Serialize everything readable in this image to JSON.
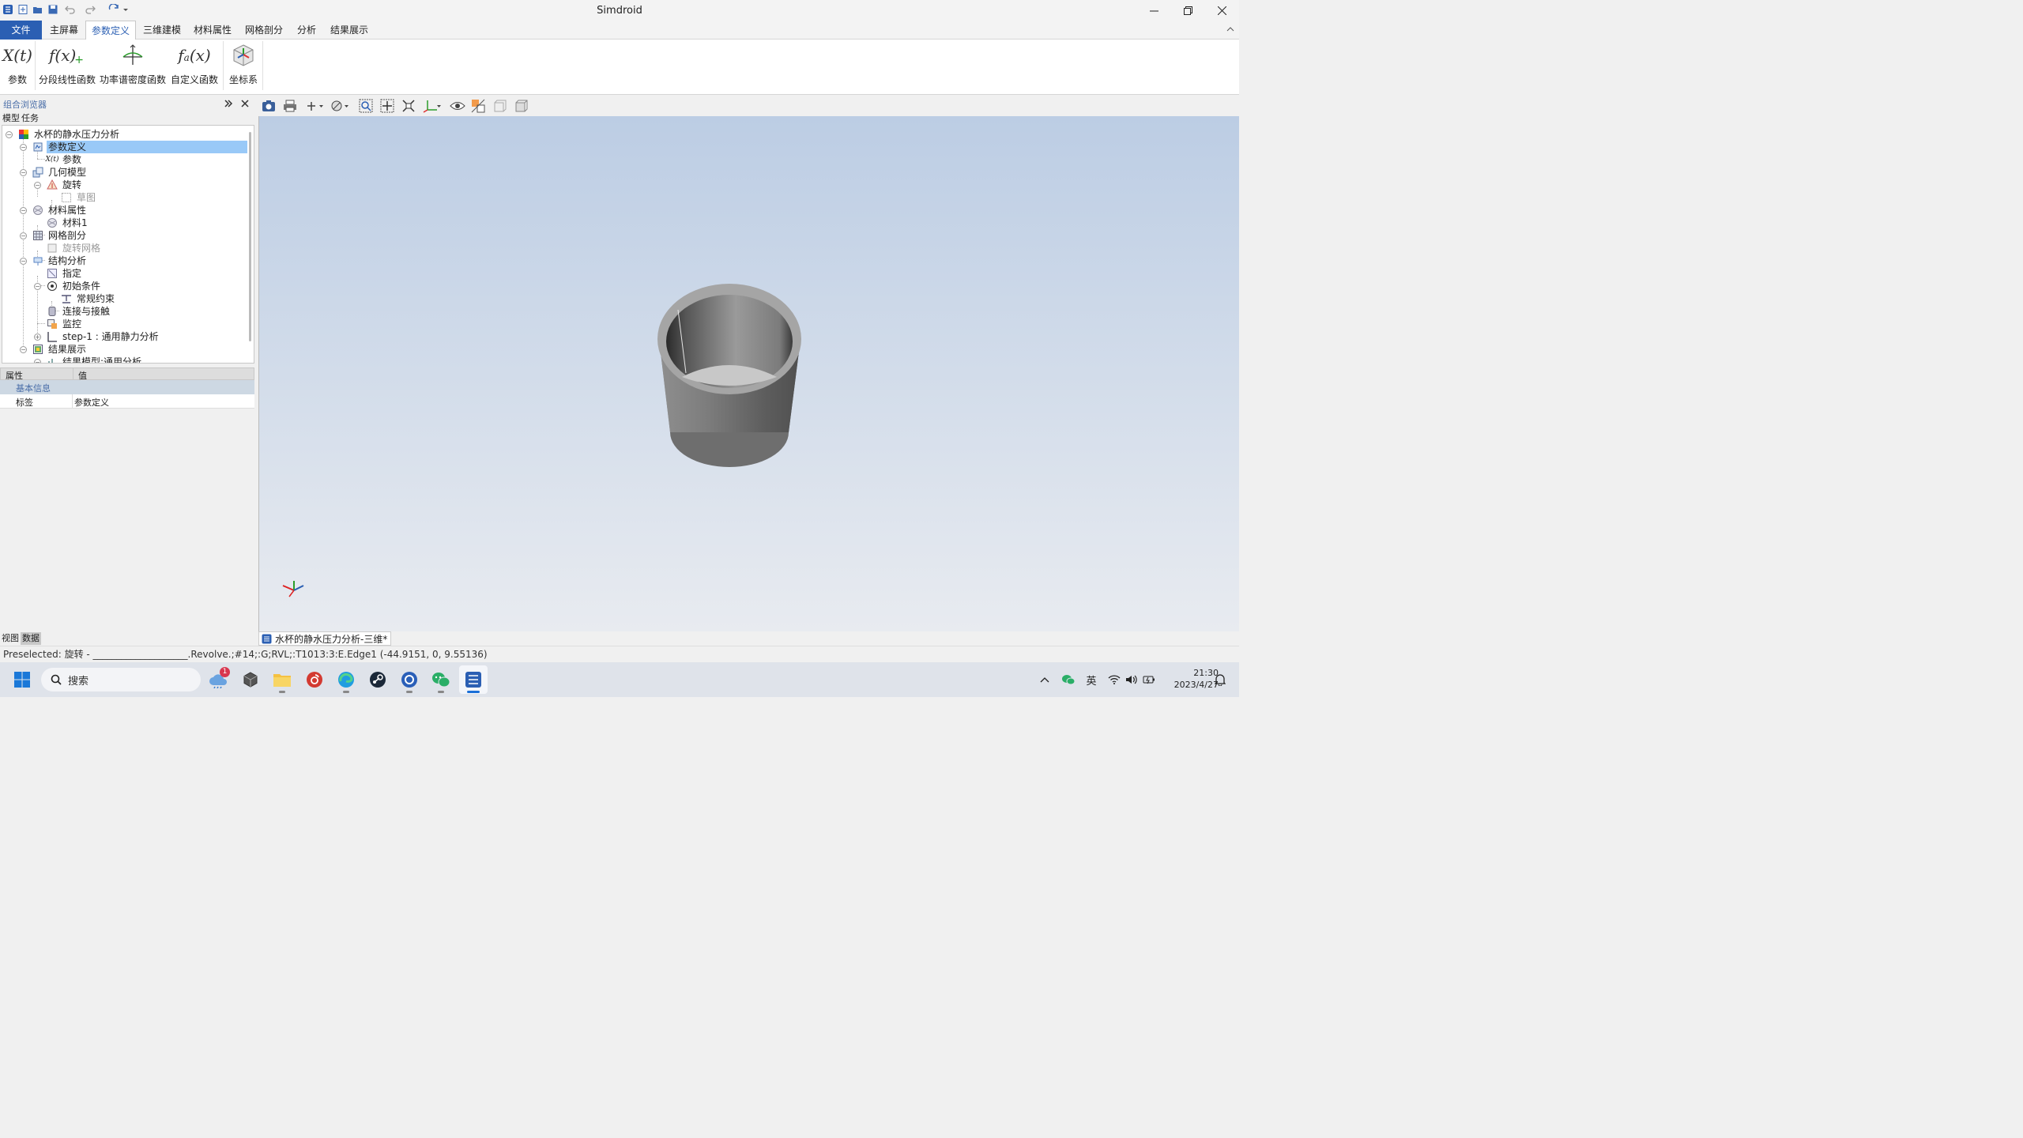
{
  "app": {
    "title": "Simdroid"
  },
  "menu": {
    "tabs": [
      {
        "label": "文件"
      },
      {
        "label": "主屏幕"
      },
      {
        "label": "参数定义"
      },
      {
        "label": "三维建模"
      },
      {
        "label": "材料属性"
      },
      {
        "label": "网格剖分"
      },
      {
        "label": "分析"
      },
      {
        "label": "结果展示"
      }
    ],
    "active": "参数定义"
  },
  "ribbon": {
    "buttons": [
      {
        "label": "参数",
        "icon": "param-x-t-icon"
      },
      {
        "label": "分段线性函数",
        "icon": "piecewise-function-icon"
      },
      {
        "label": "功率谱密度函数",
        "icon": "psd-function-icon"
      },
      {
        "label": "自定义函数",
        "icon": "custom-function-icon"
      },
      {
        "label": "坐标系",
        "icon": "coordinate-system-icon"
      }
    ]
  },
  "browser": {
    "title": "组合浏览器",
    "tabs": [
      "模型",
      "任务"
    ],
    "tree": [
      {
        "label": "水杯的静水压力分析",
        "icon": "analysis-root-icon"
      },
      {
        "label": "参数定义",
        "icon": "param-def-icon",
        "selected": true
      },
      {
        "label": "参数",
        "icon": "param-x-t-icon"
      },
      {
        "label": "几何模型",
        "icon": "geometry-icon"
      },
      {
        "label": "旋转",
        "icon": "revolve-icon"
      },
      {
        "label": "草图",
        "icon": "sketch-icon",
        "disabled": true
      },
      {
        "label": "材料属性",
        "icon": "material-icon"
      },
      {
        "label": "材料1",
        "icon": "material-icon"
      },
      {
        "label": "网格剖分",
        "icon": "mesh-icon"
      },
      {
        "label": "旋转网格",
        "icon": "mesh-item-icon",
        "disabled": true
      },
      {
        "label": "结构分析",
        "icon": "structural-icon"
      },
      {
        "label": "指定",
        "icon": "assign-icon"
      },
      {
        "label": "初始条件",
        "icon": "initial-condition-icon"
      },
      {
        "label": "常规约束",
        "icon": "constraint-icon"
      },
      {
        "label": "连接与接触",
        "icon": "contact-icon"
      },
      {
        "label": "监控",
        "icon": "monitor-icon"
      },
      {
        "label": "step-1 : 通用静力分析",
        "icon": "step-icon"
      },
      {
        "label": "结果展示",
        "icon": "results-icon"
      },
      {
        "label": "结果模型:通用分析",
        "icon": "result-model-icon"
      }
    ]
  },
  "properties": {
    "headers": [
      "属性",
      "值"
    ],
    "group": "基本信息",
    "rows": [
      {
        "name": "标签",
        "value": "参数定义"
      }
    ]
  },
  "bottom_tabs": [
    "视图",
    "数据"
  ],
  "document_tab": {
    "label": "水杯的静水压力分析-三维*"
  },
  "status": {
    "text": "Preselected: 旋转 - ____________________.Revolve.;#14;:G;RVL;:T1013:3:E.Edge1 (-44.9151, 0, 9.55136)"
  },
  "taskbar": {
    "search_placeholder": "搜索",
    "weather_badge": "1",
    "ime": "英",
    "time": "21:30",
    "date": "2023/4/27"
  },
  "colors": {
    "accent": "#2b5fb3",
    "selection": "#99c9f7",
    "viewport_top": "#bccde4",
    "viewport_bottom": "#e8ebf0"
  }
}
